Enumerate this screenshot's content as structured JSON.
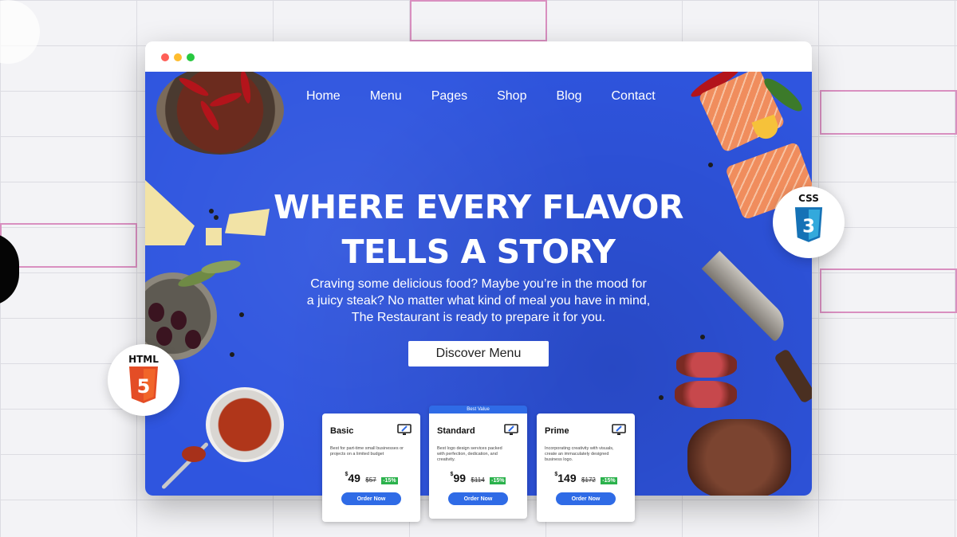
{
  "browser": {
    "controls": [
      "close",
      "minimize",
      "maximize"
    ]
  },
  "nav": {
    "items": [
      "Home",
      "Menu",
      "Pages",
      "Shop",
      "Blog",
      "Contact"
    ]
  },
  "hero": {
    "headline_line1": "WHERE EVERY FLAVOR",
    "headline_line2": "TELLS A STORY",
    "subtext_line1": "Craving some delicious food? Maybe you’re in the mood for",
    "subtext_line2": "a juicy steak? No matter what kind of meal you have in  mind,",
    "subtext_line3": "The Restaurant is ready to prepare it for you.",
    "cta_label": "Discover Menu",
    "background_color": "#2f55df"
  },
  "pricing": {
    "featured_ribbon": "Best Value",
    "plans": [
      {
        "name": "Basic",
        "description": "Best for part-time small businesses or projects on a limited budget",
        "currency": "$",
        "price": "49",
        "old_price": "$57",
        "discount": "-15%",
        "button": "Order Now"
      },
      {
        "name": "Standard",
        "description": "Best logo design services packed with perfection, dedication, and creativity.",
        "currency": "$",
        "price": "99",
        "old_price": "$114",
        "discount": "-15%",
        "button": "Order Now"
      },
      {
        "name": "Prime",
        "description": "Incorporating creativity with visuals, create an immaculately designed business logo.",
        "currency": "$",
        "price": "149",
        "old_price": "$172",
        "discount": "-15%",
        "button": "Order Now"
      }
    ]
  },
  "badges": {
    "html_label": "HTML",
    "html_number": "5",
    "css_label": "CSS",
    "css_number": "3",
    "html_color": "#e44d26",
    "css_color": "#1572b6"
  },
  "accent_colors": {
    "button_blue": "#2f6be6",
    "discount_green": "#2bb24c"
  }
}
